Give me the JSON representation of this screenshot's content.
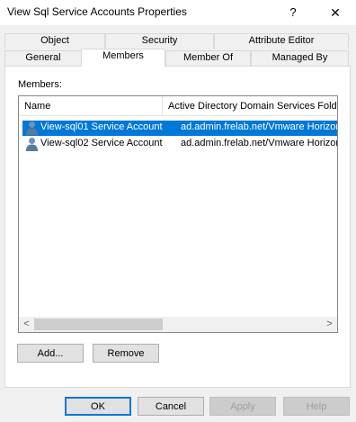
{
  "window": {
    "title": "View Sql Service Accounts Properties",
    "help_label": "?",
    "close_label": "✕"
  },
  "tabs": {
    "row_back": [
      "Object",
      "Security",
      "Attribute Editor"
    ],
    "row_front": [
      "General",
      "Members",
      "Member Of",
      "Managed By"
    ],
    "selected": "Members"
  },
  "members": {
    "label": "Members:",
    "columns": [
      "Name",
      "Active Directory Domain Services Folder"
    ],
    "rows": [
      {
        "name": "View-sql01 Service Account",
        "folder": "ad.admin.frelab.net/Vmware Horizon View",
        "selected": true
      },
      {
        "name": "View-sql02 Service Account",
        "folder": "ad.admin.frelab.net/Vmware Horizon View",
        "selected": false
      }
    ],
    "scroll_left": "<",
    "scroll_right": ">"
  },
  "actions": {
    "add_label": "Add...",
    "remove_label": "Remove"
  },
  "footer": {
    "ok_label": "OK",
    "cancel_label": "Cancel",
    "apply_label": "Apply",
    "help_label": "Help"
  },
  "colors": {
    "selection": "#0078d7",
    "icon_user_head": "#6f92b5",
    "icon_user_body": "#5a7a9a"
  }
}
